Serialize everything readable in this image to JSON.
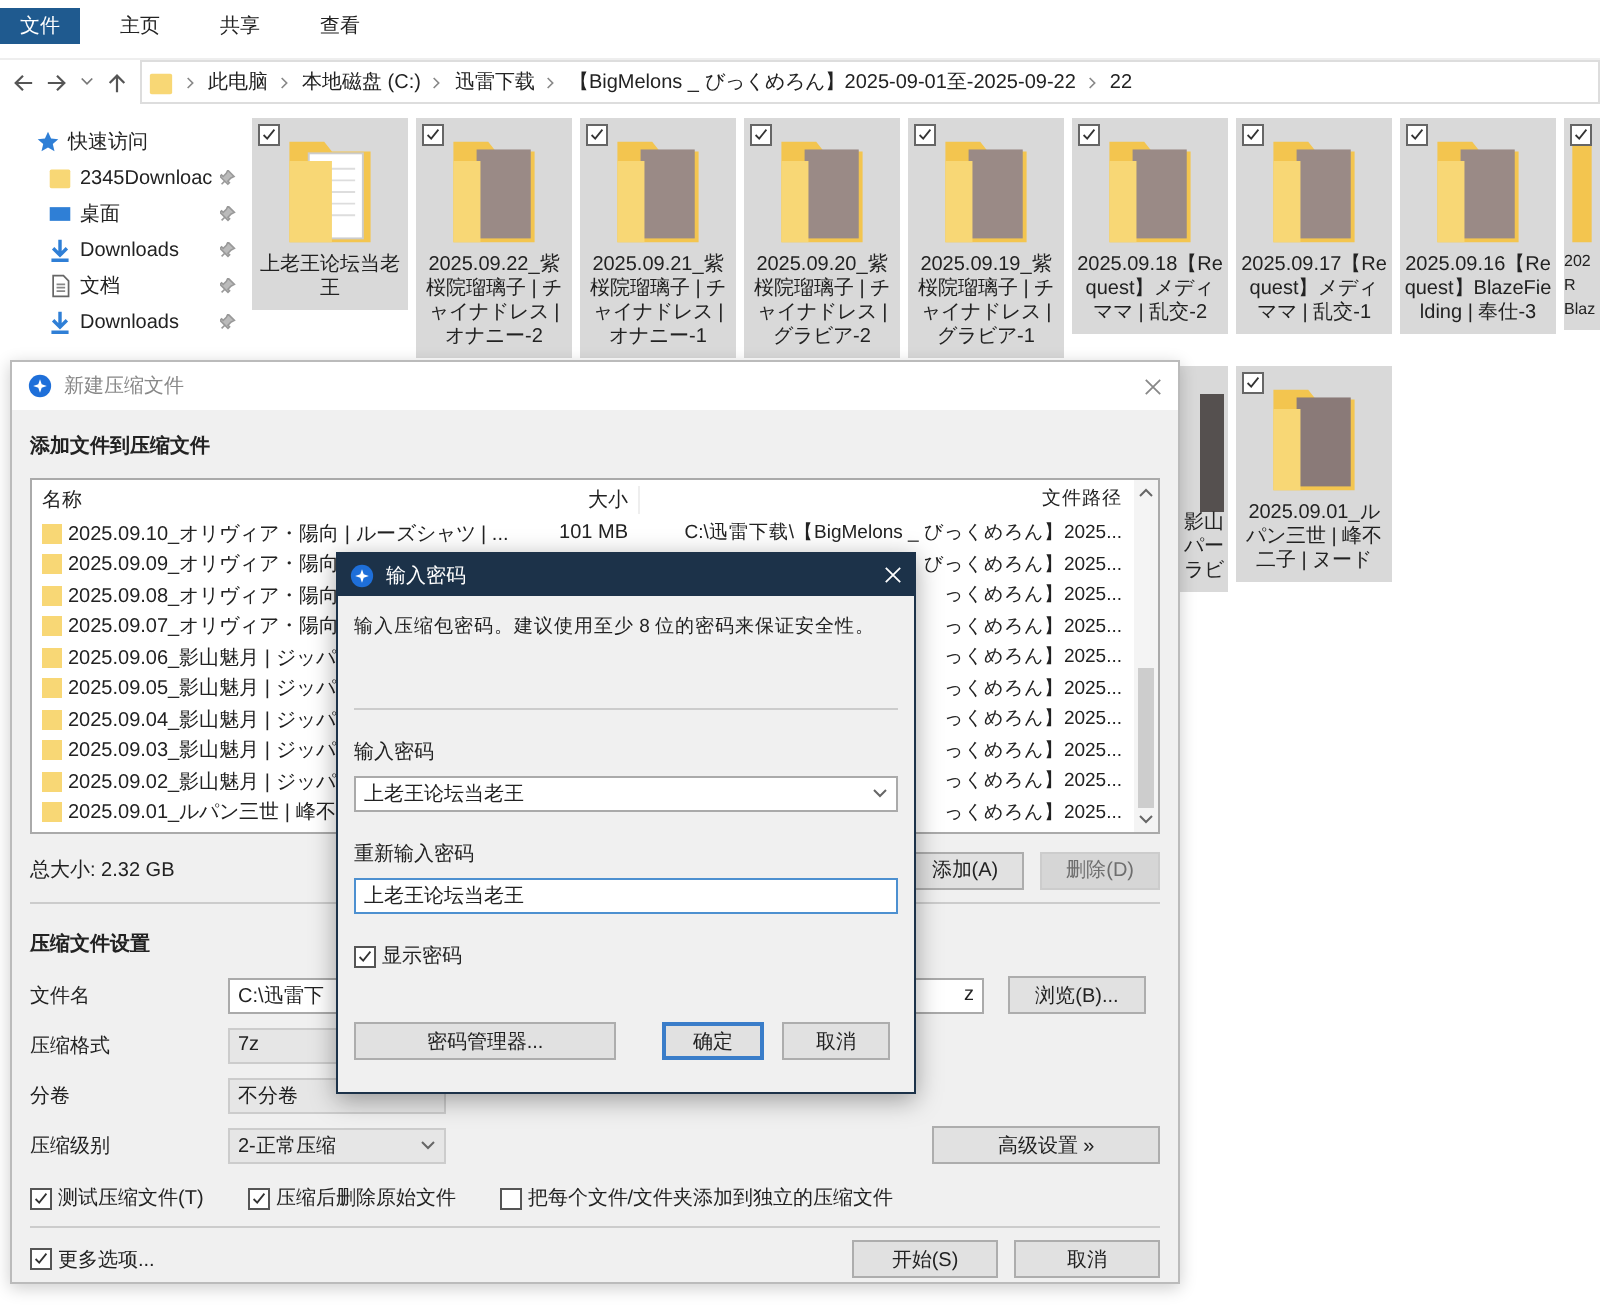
{
  "explorer": {
    "ribbon_tabs": [
      {
        "label": "文件",
        "selected": true
      },
      {
        "label": "主页",
        "selected": false
      },
      {
        "label": "共享",
        "selected": false
      },
      {
        "label": "查看",
        "selected": false
      }
    ],
    "address": {
      "crumbs": [
        "此电脑",
        "本地磁盘 (C:)",
        "迅雷下载",
        "【BigMelons _ びっくめろん】2025-09-01至-2025-09-22",
        "22"
      ]
    },
    "sidebar": [
      {
        "label": "快速访问",
        "kind": "star"
      },
      {
        "label": "2345Downloac",
        "kind": "folder"
      },
      {
        "label": "桌面",
        "kind": "desktop"
      },
      {
        "label": "Downloads",
        "kind": "download"
      },
      {
        "label": "文档",
        "kind": "document"
      },
      {
        "label": "Downloads",
        "kind": "download"
      }
    ],
    "tiles": [
      {
        "label": "上老王论坛当老王",
        "kind": "documents",
        "checked": true
      },
      {
        "label": "2025.09.22_紫桜院瑠璃子 | チャイナドレス | オナニー-2",
        "kind": "photo",
        "checked": true
      },
      {
        "label": "2025.09.21_紫桜院瑠璃子 | チャイナドレス | オナニー-1",
        "kind": "photo",
        "checked": true
      },
      {
        "label": "2025.09.20_紫桜院瑠璃子 | チャイナドレス | グラビア-2",
        "kind": "photo",
        "checked": true
      },
      {
        "label": "2025.09.19_紫桜院瑠璃子 | チャイナドレス | グラビア-1",
        "kind": "photo",
        "checked": true
      },
      {
        "label": "2025.09.18【Request】メディママ | 乱交-2",
        "kind": "photo",
        "checked": true
      },
      {
        "label": "2025.09.17【Request】メディママ | 乱交-1",
        "kind": "photo",
        "checked": true
      },
      {
        "label": "2025.09.16【Request】BlazeFielding | 奉仕-3",
        "kind": "photo",
        "checked": true
      },
      {
        "lines": [
          "202",
          "R",
          "Blaz"
        ],
        "kind": "partial",
        "checked": true
      }
    ],
    "tiles_row2": [
      {
        "lines": [
          "影山",
          "パー",
          "ラビ"
        ],
        "kind": "partial"
      },
      {
        "label": "2025.09.01_ルパン三世 | 峰不二子 | ヌード",
        "kind": "photo",
        "checked": true
      }
    ]
  },
  "archive_dialog": {
    "title": "新建压缩文件",
    "heading": "添加文件到压缩文件",
    "columns": [
      "名称",
      "大小",
      "文件路径"
    ],
    "rows": [
      {
        "name": "2025.09.10_オリヴィア・陽向 | ルーズシャツ | ...",
        "size": "101 MB",
        "path": "C:\\迅雷下载\\【BigMelons _ びっくめろん】2025..."
      },
      {
        "name": "2025.09.09_オリヴィア・陽向",
        "path": "びっくめろん】2025..."
      },
      {
        "name": "2025.09.08_オリヴィア・陽向",
        "path": "っくめろん】2025..."
      },
      {
        "name": "2025.09.07_オリヴィア・陽向",
        "path": "っくめろん】2025..."
      },
      {
        "name": "2025.09.06_影山魅月 | ジッパ",
        "path": "っくめろん】2025..."
      },
      {
        "name": "2025.09.05_影山魅月 | ジッパ",
        "path": "っくめろん】2025..."
      },
      {
        "name": "2025.09.04_影山魅月 | ジッパ",
        "path": "っくめろん】2025..."
      },
      {
        "name": "2025.09.03_影山魅月 | ジッパ",
        "path": "っくめろん】2025..."
      },
      {
        "name": "2025.09.02_影山魅月 | ジッパ",
        "path": "っくめろん】2025..."
      },
      {
        "name": "2025.09.01_ルパン三世 | 峰不",
        "path": "っくめろん】2025..."
      }
    ],
    "total": "总大小: 2.32 GB",
    "list_buttons": [
      {
        "label": "添加(A)",
        "disabled": false
      },
      {
        "label": "删除(D)",
        "disabled": true
      }
    ],
    "settings_heading": "压缩文件设置",
    "filename": {
      "label": "文件名",
      "value": "C:\\迅雷下",
      "value_end": "z",
      "button": "浏览(B)..."
    },
    "format": {
      "label": "压缩格式",
      "value": "7z"
    },
    "split": {
      "label": "分卷",
      "value": "不分卷"
    },
    "level": {
      "label": "压缩级别",
      "value": "2-正常压缩",
      "button": "高级设置 »"
    },
    "options": [
      {
        "label": "测试压缩文件(T)",
        "checked": true
      },
      {
        "label": "压缩后删除原始文件",
        "checked": true
      },
      {
        "label": "把每个文件/文件夹添加到独立的压缩文件",
        "checked": false
      }
    ],
    "more": {
      "label": "更多选项...",
      "checked": true
    },
    "buttons": [
      "开始(S)",
      "取消"
    ]
  },
  "password_dialog": {
    "title": "输入密码",
    "description": "输入压缩包密码。建议使用至少 8 位的密码来保证安全性。",
    "password_label": "输入密码",
    "password": "上老王论坛当老王",
    "confirm_label": "重新输入密码",
    "confirm": "上老王论坛当老王",
    "show_password": {
      "label": "显示密码",
      "checked": true
    },
    "buttons": [
      {
        "label": "密码管理器...",
        "default": false
      },
      {
        "label": "确定",
        "default": true
      },
      {
        "label": "取消",
        "default": false
      }
    ]
  }
}
